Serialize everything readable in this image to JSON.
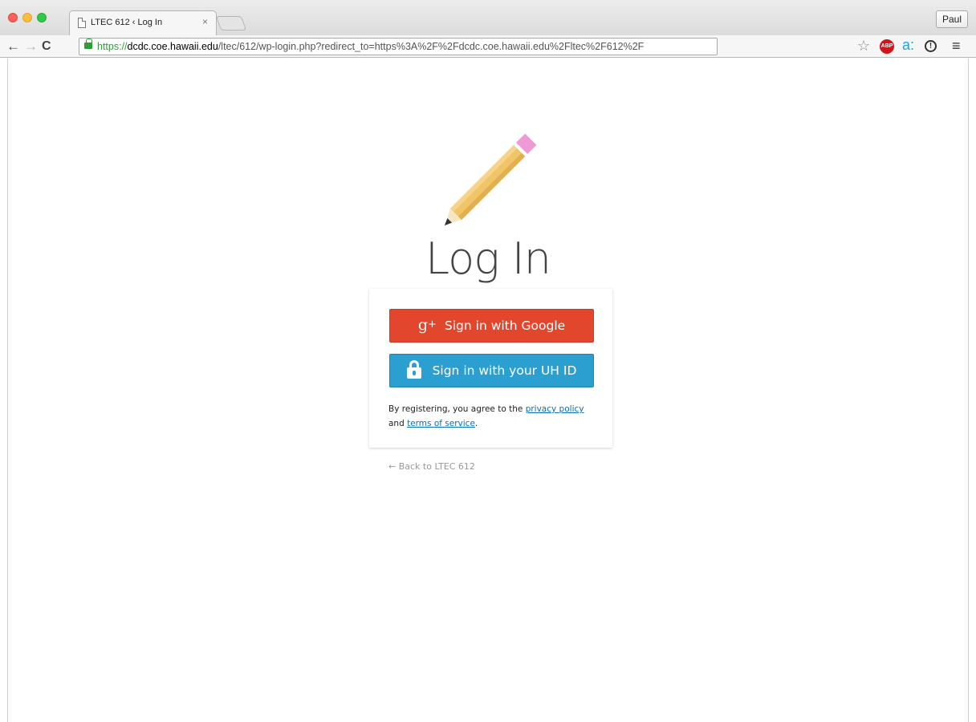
{
  "browser": {
    "tab_title": "LTEC 612 ‹ Log In",
    "tab_close": "×",
    "profile_name": "Paul",
    "url": {
      "scheme": "https://",
      "host": "dcdc.coe.hawaii.edu",
      "path": "/ltec/612/wp-login.php?redirect_to=https%3A%2F%2Fdcdc.coe.hawaii.edu%2Fltec%2F612%2F"
    },
    "icons": {
      "back": "←",
      "forward": "→",
      "reload": "C",
      "star": "☆",
      "abp": "ABP",
      "amazon": "a:",
      "info": "!",
      "menu": "≡"
    }
  },
  "page": {
    "title": "Log In",
    "google_button": "Sign in with Google",
    "google_icon": "g",
    "google_icon_plus": "+",
    "uh_button": "Sign in with your UH ID",
    "legal": {
      "prefix": "By registering, you agree to the ",
      "privacy_link": "privacy policy",
      "middle": "and ",
      "terms_link": "terms of service",
      "suffix": "."
    },
    "back_link": "← Back to LTEC 612"
  },
  "colors": {
    "google_red": "#e2472e",
    "uh_blue": "#2a9fd0",
    "link_blue": "#0a6fb5",
    "pencil_body": "#f0c468",
    "pencil_eraser": "#ef9ad6"
  }
}
